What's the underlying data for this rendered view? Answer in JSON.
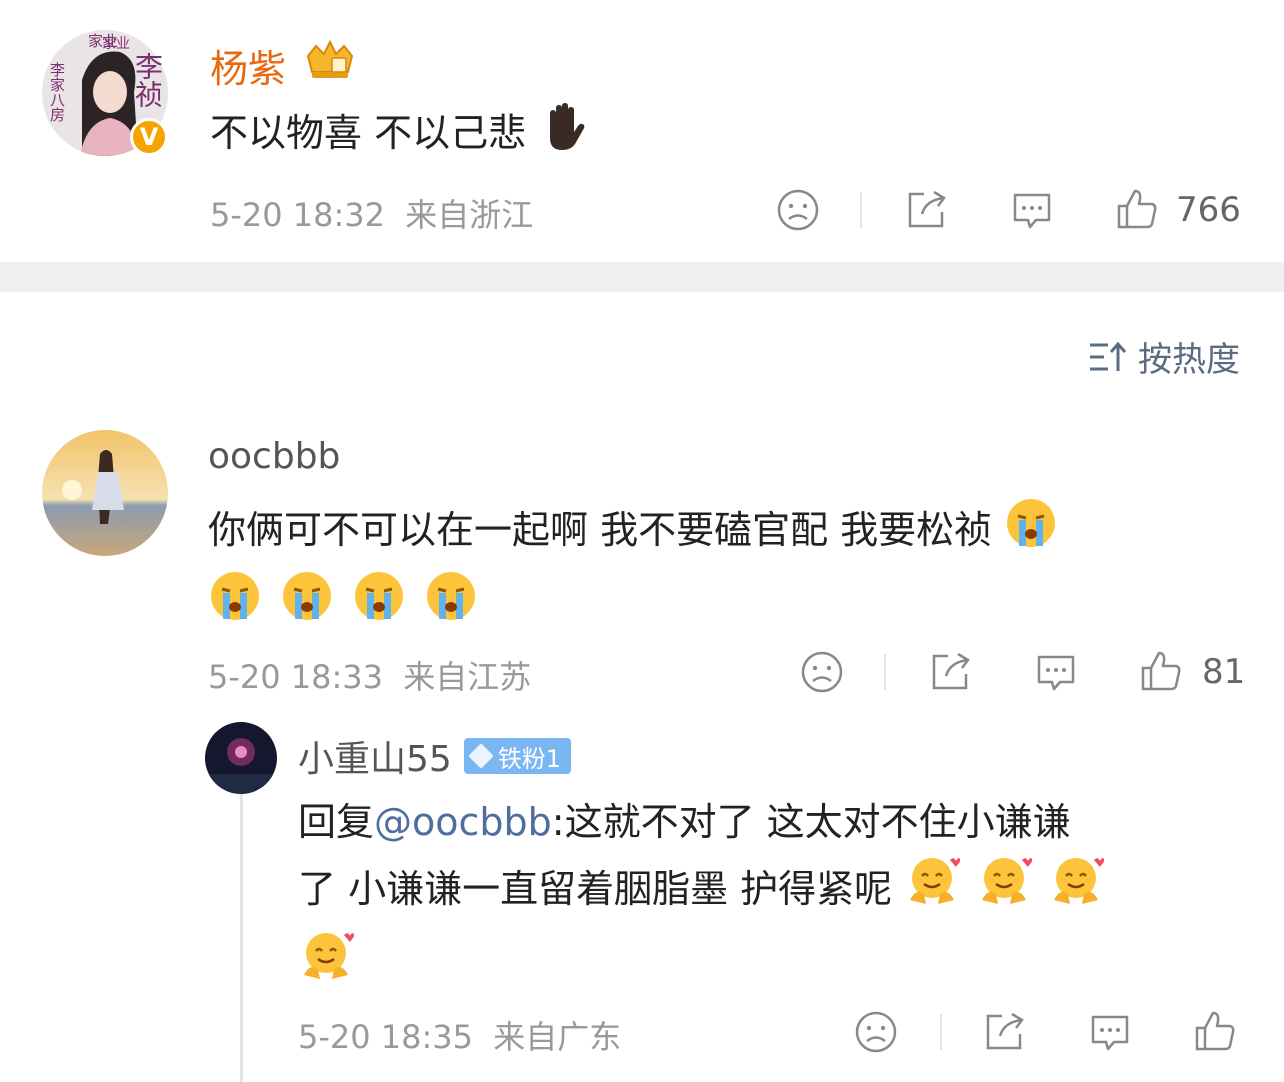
{
  "post": {
    "author": "杨紫",
    "text": "不以物喜 不以己悲",
    "time": "5-20 18:32",
    "location": "来自浙江",
    "likes": "766",
    "avatar_text_1": "家业",
    "avatar_text_2": "李祯",
    "avatar_text_3": "李家八房"
  },
  "sort": {
    "label": "按热度"
  },
  "comments": [
    {
      "author": "oocbbb",
      "text_line1": "你俩可不可以在一起啊 我不要磕官配 我要松祯",
      "time": "5-20 18:33",
      "location": "来自江苏",
      "likes": "81"
    }
  ],
  "reply": {
    "author": "小重山55",
    "badge": "铁粉1",
    "prefix": "回复",
    "mention": "@oocbbb",
    "text_line1": ":这就不对了 这太对不住小谦谦",
    "text_line2": "了 小谦谦一直留着胭脂墨 护得紧呢",
    "time": "5-20 18:35",
    "location": "来自广东"
  },
  "colors": {
    "author_orange": "#e86a10",
    "meta_gray": "#999999",
    "link_blue": "#4e6e9e",
    "badge_blue": "#7ab6f2"
  }
}
